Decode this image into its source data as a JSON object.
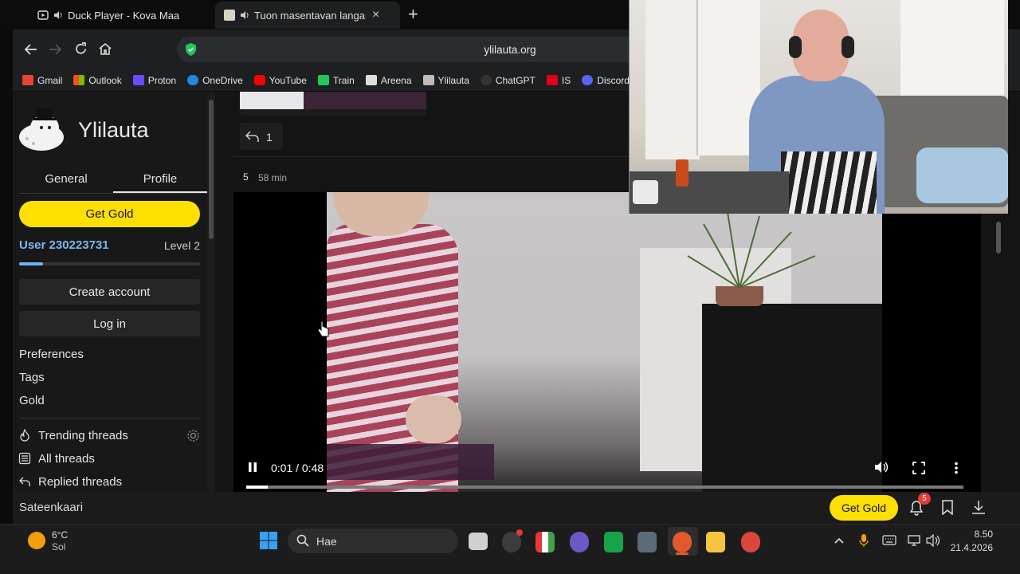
{
  "tabs": [
    {
      "title": "Duck Player - Kova Maa",
      "icon": "duck-player-icon"
    },
    {
      "title": "Tuon masentavan langan",
      "icon": "ylilauta-tab-icon",
      "close": "×"
    }
  ],
  "new_tab": "+",
  "address": "ylilauta.org",
  "bookmarks": [
    {
      "label": "Gmail",
      "color": "#ea4335"
    },
    {
      "label": "Outlook",
      "color": "#0f78d4"
    },
    {
      "label": "Proton",
      "color": "#6d4aff"
    },
    {
      "label": "OneDrive",
      "color": "#1e88e5"
    },
    {
      "label": "YouTube",
      "color": "#ff0000"
    },
    {
      "label": "Train",
      "color": "#22c55e"
    },
    {
      "label": "Areena",
      "color": "#dddddd"
    },
    {
      "label": "Ylilauta",
      "color": "#999999"
    },
    {
      "label": "ChatGPT",
      "color": "#333333"
    },
    {
      "label": "IS",
      "color": "#e2001a"
    },
    {
      "label": "Discord",
      "color": "#5865f2"
    }
  ],
  "sidebar": {
    "site_name": "Ylilauta",
    "tabs": [
      "General",
      "Profile"
    ],
    "get_gold": "Get Gold",
    "user": "User 230223731",
    "level": "Level 2",
    "level_progress": 0.13,
    "create_account": "Create account",
    "log_in": "Log in",
    "links": [
      "Preferences",
      "Tags",
      "Gold"
    ],
    "threads": [
      "Trending threads",
      "All threads",
      "Replied threads"
    ]
  },
  "post": {
    "reply_count": "1",
    "number": "5",
    "age": "58 min"
  },
  "video": {
    "time": "0:01 / 0:48",
    "progress": 0.03
  },
  "bottombar": {
    "board": "Sateenkaari",
    "get_gold": "Get Gold",
    "notifications": "5"
  },
  "taskbar": {
    "temp": "6°C",
    "weather": "Sol",
    "search": "Hae",
    "time": "8.50",
    "date": "21.4.2026"
  }
}
